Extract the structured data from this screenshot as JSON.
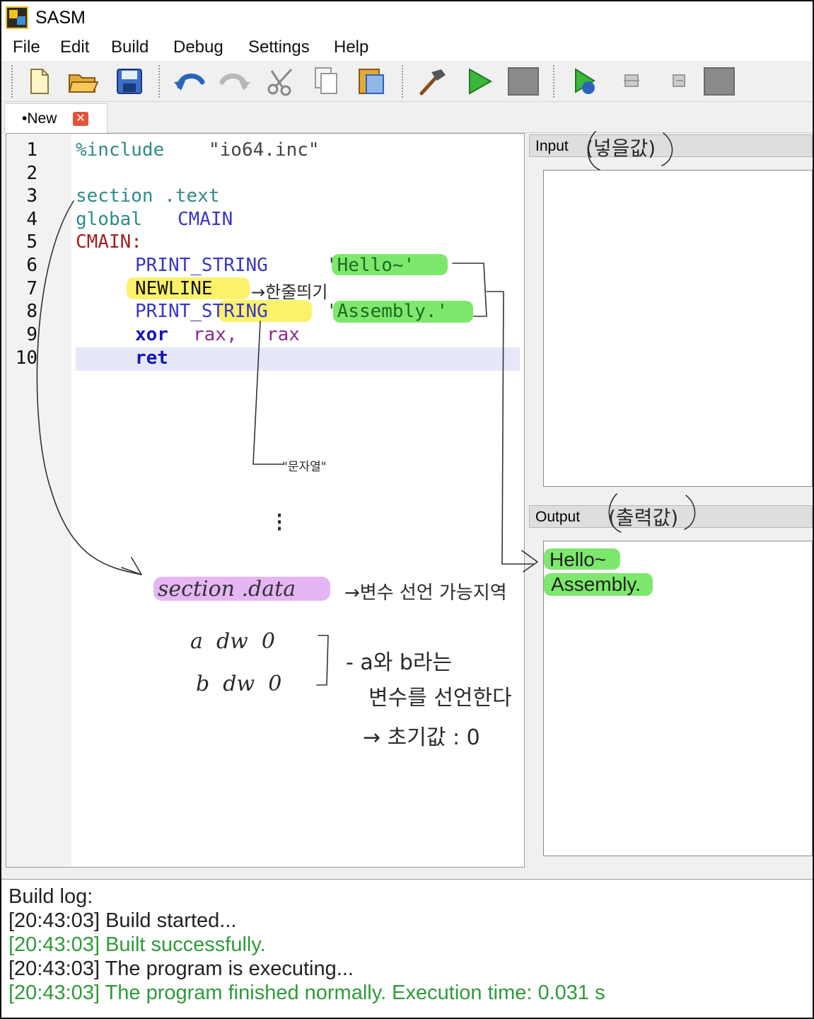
{
  "window": {
    "title": "SASM"
  },
  "menu": [
    "File",
    "Edit",
    "Build",
    "Debug",
    "Settings",
    "Help"
  ],
  "toolbar": {
    "buttons": [
      "new-file-icon",
      "open-folder-icon",
      "save-icon",
      "undo-icon",
      "redo-icon",
      "cut-icon",
      "copy-icon",
      "paste-icon",
      "build-hammer-icon",
      "run-icon",
      "stop-icon",
      "debug-icon",
      "step-into-icon",
      "step-over-icon",
      "debug-stop-icon"
    ]
  },
  "tab": {
    "label": "•New",
    "close": "✕"
  },
  "editor": {
    "line_numbers": [
      "1",
      "2",
      "3",
      "4",
      "5",
      "6",
      "7",
      "8",
      "9",
      "10"
    ],
    "lines": {
      "l1_directive": "%include",
      "l1_file": "\"io64.inc\"",
      "l3_section": "section .text",
      "l4_global": "global",
      "l4_name": "CMAIN",
      "l5_label": "CMAIN:",
      "l6_macro": "PRINT_STRING",
      "l6_str": "'Hello~'",
      "l7_macro": "NEWLINE",
      "l8_macro": "PRINT_STRING",
      "l8_str": "'Assembly.'",
      "l9_op": "xor",
      "l9_reg1": "rax,",
      "l9_reg2": "rax",
      "l10_op": "ret"
    }
  },
  "annotations": {
    "newline_note": "→한줄띄기",
    "string_note": "\"문자열\"",
    "dots": "⁝",
    "section_data": "section .data",
    "section_data_note": "→변수 선언 가능지역",
    "var_a": "a  dw  0",
    "var_b": "b  dw  0",
    "var_note_1": "- a와 b라는",
    "var_note_2": "변수를 선언한다",
    "var_note_3": "→ 초기값 : 0",
    "input_note": "(넣을값)",
    "output_note": "(출력값)"
  },
  "panels": {
    "input_label": "Input",
    "output_label": "Output",
    "output_lines": [
      "Hello~",
      "Assembly."
    ]
  },
  "build_log": {
    "title": "Build log:",
    "entries": [
      {
        "time": "[20:43:03]",
        "text": "Build started...",
        "status": "normal"
      },
      {
        "time": "[20:43:03]",
        "text": "Built successfully.",
        "status": "ok"
      },
      {
        "time": "[20:43:03]",
        "text": "The program is executing...",
        "status": "normal"
      },
      {
        "time": "[20:43:03]",
        "text": "The program finished normally. Execution time: 0.031 s",
        "status": "ok"
      }
    ]
  },
  "colors": {
    "highlight_green": "#7de86d",
    "highlight_yellow": "#fbf26a",
    "highlight_purple": "#e5b6f3",
    "log_success": "#2f9a3a",
    "current_line": "#e6e8fa"
  }
}
